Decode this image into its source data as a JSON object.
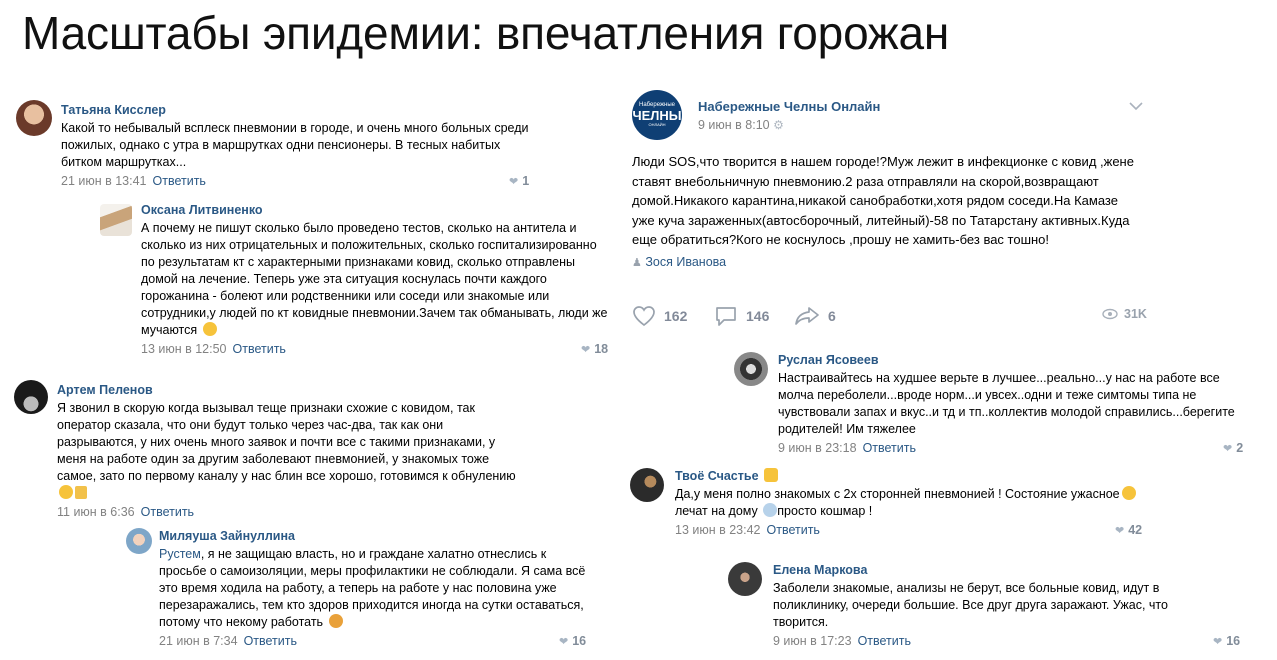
{
  "title": "Масштабы эпидемии: впечатления горожан",
  "left_column": [
    {
      "name": "Татьяна Кисслер",
      "text": "Какой то небывалый всплеск пневмонии в городе, и очень много больных среди пожилых, однако с утра в маршрутках одни пенсионеры. В тесных набитых битком маршрутках...",
      "date": "21 июн в 13:41",
      "reply": "Ответить",
      "likes": "1"
    },
    {
      "name": "Оксана Литвиненко",
      "text": "А почему не пишут сколько было проведено тестов, сколько на антитела и сколько из них отрицательных и положительных, сколько госпитализированно по результатам кт с характерными признаками ковид, сколько отправлены домой на лечение. Теперь уже эта ситуация коснулась почти каждого горожанина - болеют или родственники или соседи или знакомые или сотрудники,у людей по кт ковидные пневмонии.Зачем так обманывать, люди же мучаются",
      "date": "13 июн в 12:50",
      "reply": "Ответить",
      "likes": "18"
    },
    {
      "name": "Артем Пеленов",
      "text": "Я звонил в скорую когда вызывал теще признаки схожие с ковидом, так оператор сказала, что они будут только через час-два, так как они разрываются, у них очень много заявок и почти все с такими признаками, у меня на работе один за другим заболевают пневмонией, у знакомых тоже самое, зато по первому каналу у нас блин все хорошо, готовимся к обнулению",
      "date": "11 июн в 6:36",
      "reply": "Ответить",
      "likes": ""
    },
    {
      "name": "Миляуша Зайнуллина",
      "mention": "Рустем",
      "text": ", я не защищаю власть, но и граждане халатно отнеслись к просьбе о самоизоляции, меры профилактики не соблюдали. Я сама всё это время ходила на работу, а теперь на работе у нас половина уже перезаражались, тем кто здоров приходится иногда на сутки оставаться, потому что некому работать",
      "date": "21 июн в 7:34",
      "reply": "Ответить",
      "likes": "16"
    }
  ],
  "post": {
    "community": "Набережные Челны Онлайн",
    "logo_top": "Набережные",
    "logo_main": "ЧЕЛНЫ",
    "logo_sub": "ОНЛАЙН",
    "date": "9 июн в 8:10",
    "text": "Люди SOS,что творится в нашем городе!?Муж лежит в инфекционке с ковид ,жене ставят внебольничную пневмонию.2 раза отправляли на скорой,возвращают домой.Никакого карантина,никакой санобработки,хотя рядом соседи.На Камазе уже куча зараженных(автосборочный, литейный)-58 по Татарстану активных.Куда еще обратиться?Кого не коснулось ,прошу не хамить-без вас тошно!",
    "author": "Зося Иванова",
    "likes": "162",
    "comments": "146",
    "shares": "6",
    "views": "31K"
  },
  "right_column": [
    {
      "name": "Руслан Ясовеев",
      "text": "Настраивайтесь на худшее верьте в лучшее...реально...у нас на работе все молча переболели...вроде норм...и увсех..одни и теже симтомы типа не чувствовали запах и вкус..и тд и тп..коллектив молодой справились...берегите родителей! Им тяжелее",
      "date": "9 июн в 23:18",
      "reply": "Ответить",
      "likes": "2"
    },
    {
      "name": "Твоё Счастье",
      "text_a": "Да,у меня полно знакомых с 2х сторонней пневмонией ! Состояние ужасное",
      "text_b": "лечат на дому",
      "text_c": "просто кошмар !",
      "date": "13 июн в 23:42",
      "reply": "Ответить",
      "likes": "42"
    },
    {
      "name": "Елена Маркова",
      "text": "Заболели знакомые, анализы не берут, все больные ковид, идут в поликлинику, очереди большие. Все друг друга заражают. Ужас, что творится.",
      "date": "9 июн в 17:23",
      "reply": "Ответить",
      "likes": "16"
    }
  ],
  "colors": {
    "link": "#2a5885",
    "muted": "#828282",
    "logo_bg": "#0f3f74"
  }
}
